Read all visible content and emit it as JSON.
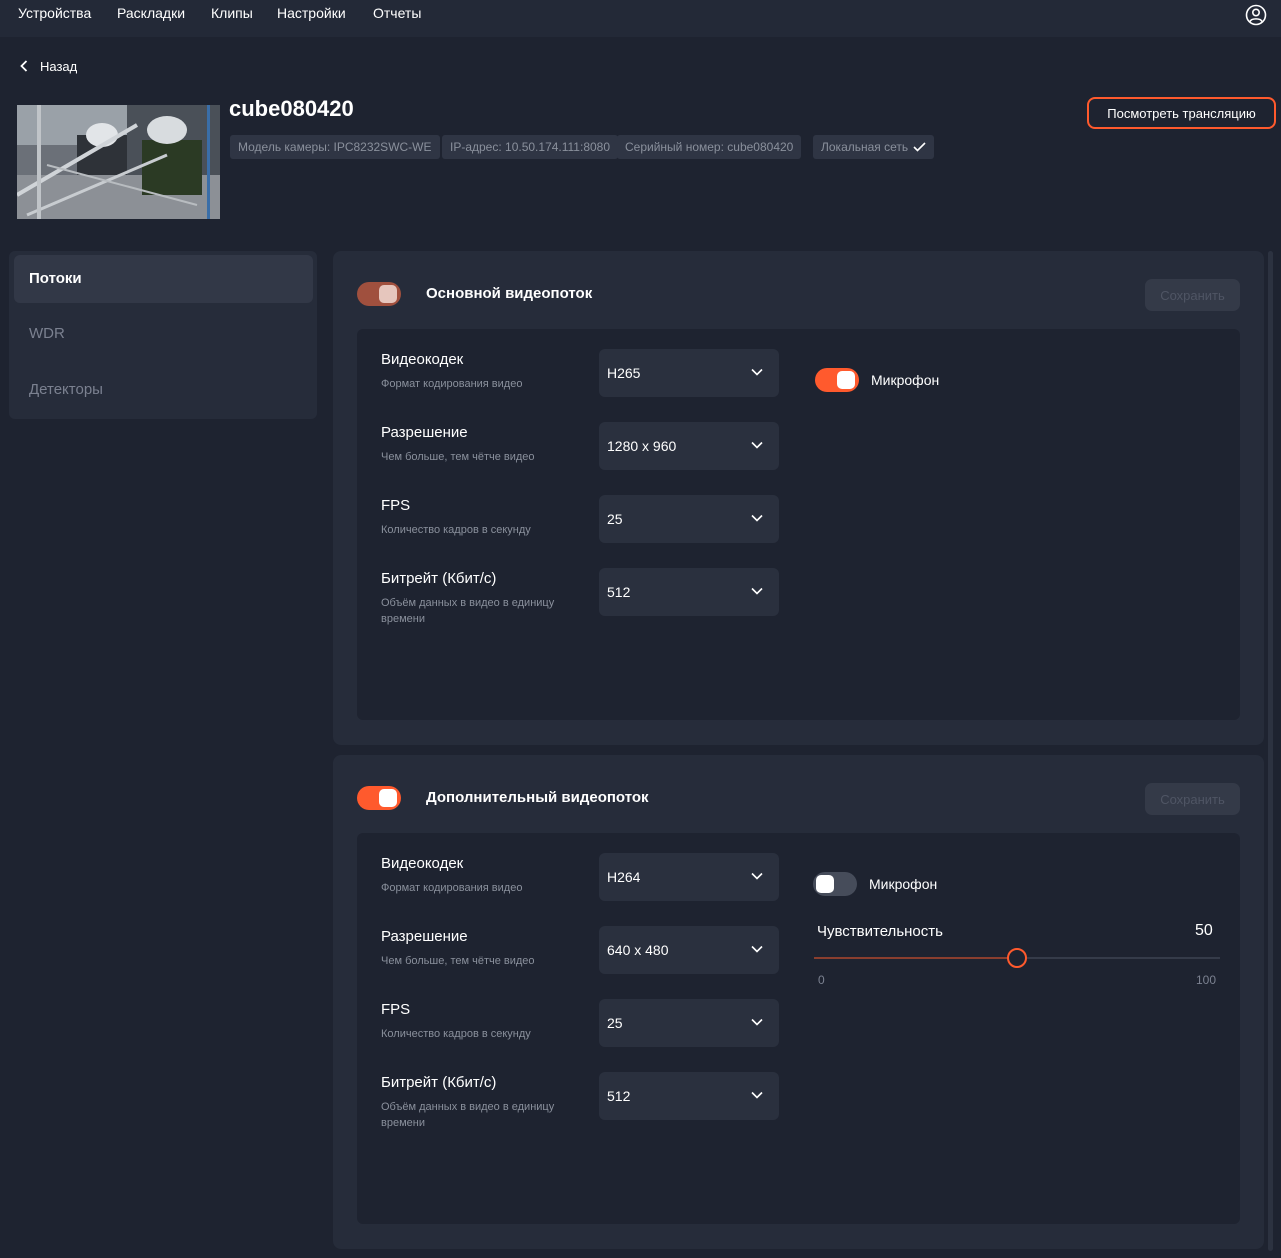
{
  "nav": {
    "items": [
      "Устройства",
      "Раскладки",
      "Клипы",
      "Настройки",
      "Отчеты"
    ],
    "user_icon": "user-circle-icon"
  },
  "back": {
    "label": "Назад"
  },
  "device": {
    "name": "cube080420",
    "watch_button": "Посмотреть трансляцию",
    "model": "Модель камеры: IPC8232SWC-WE",
    "ip": "IP-адрес: 10.50.174.111:8080",
    "serial": "Серийный номер: cube080420",
    "network": "Локальная сеть"
  },
  "sidebar": {
    "items": [
      {
        "label": "Потоки",
        "active": true
      },
      {
        "label": "WDR",
        "active": false
      },
      {
        "label": "Детекторы",
        "active": false
      }
    ]
  },
  "colors": {
    "accent": "#ff5a2d",
    "accent_dim": "#a0503e",
    "bg": "#1e2330",
    "panel": "#262c3a"
  },
  "streams": [
    {
      "title": "Основной видеопоток",
      "enabled": true,
      "save_label": "Сохранить",
      "fields": [
        {
          "label": "Видеокодек",
          "desc": "Формат кодирования видео",
          "value": "H265"
        },
        {
          "label": "Разрешение",
          "desc": "Чем больше, тем чётче видео",
          "value": "1280 x 960"
        },
        {
          "label": "FPS",
          "desc": "Количество кадров в секунду",
          "value": "25"
        },
        {
          "label": "Битрейт (Кбит/с)",
          "desc": "Объём данных в видео в единицу времени",
          "value": "512"
        }
      ],
      "mic": {
        "label": "Микрофон",
        "enabled": true
      }
    },
    {
      "title": "Дополнительный видеопоток",
      "enabled": true,
      "save_label": "Сохранить",
      "fields": [
        {
          "label": "Видеокодек",
          "desc": "Формат кодирования видео",
          "value": "H264"
        },
        {
          "label": "Разрешение",
          "desc": "Чем больше, тем чётче видео",
          "value": "640 x 480"
        },
        {
          "label": "FPS",
          "desc": "Количество кадров в секунду",
          "value": "25"
        },
        {
          "label": "Битрейт (Кбит/с)",
          "desc": "Объём данных в видео в единицу времени",
          "value": "512"
        }
      ],
      "mic": {
        "label": "Микрофон",
        "enabled": false
      },
      "sensitivity": {
        "label": "Чувствительность",
        "value": "50",
        "min": "0",
        "max": "100"
      }
    }
  ]
}
